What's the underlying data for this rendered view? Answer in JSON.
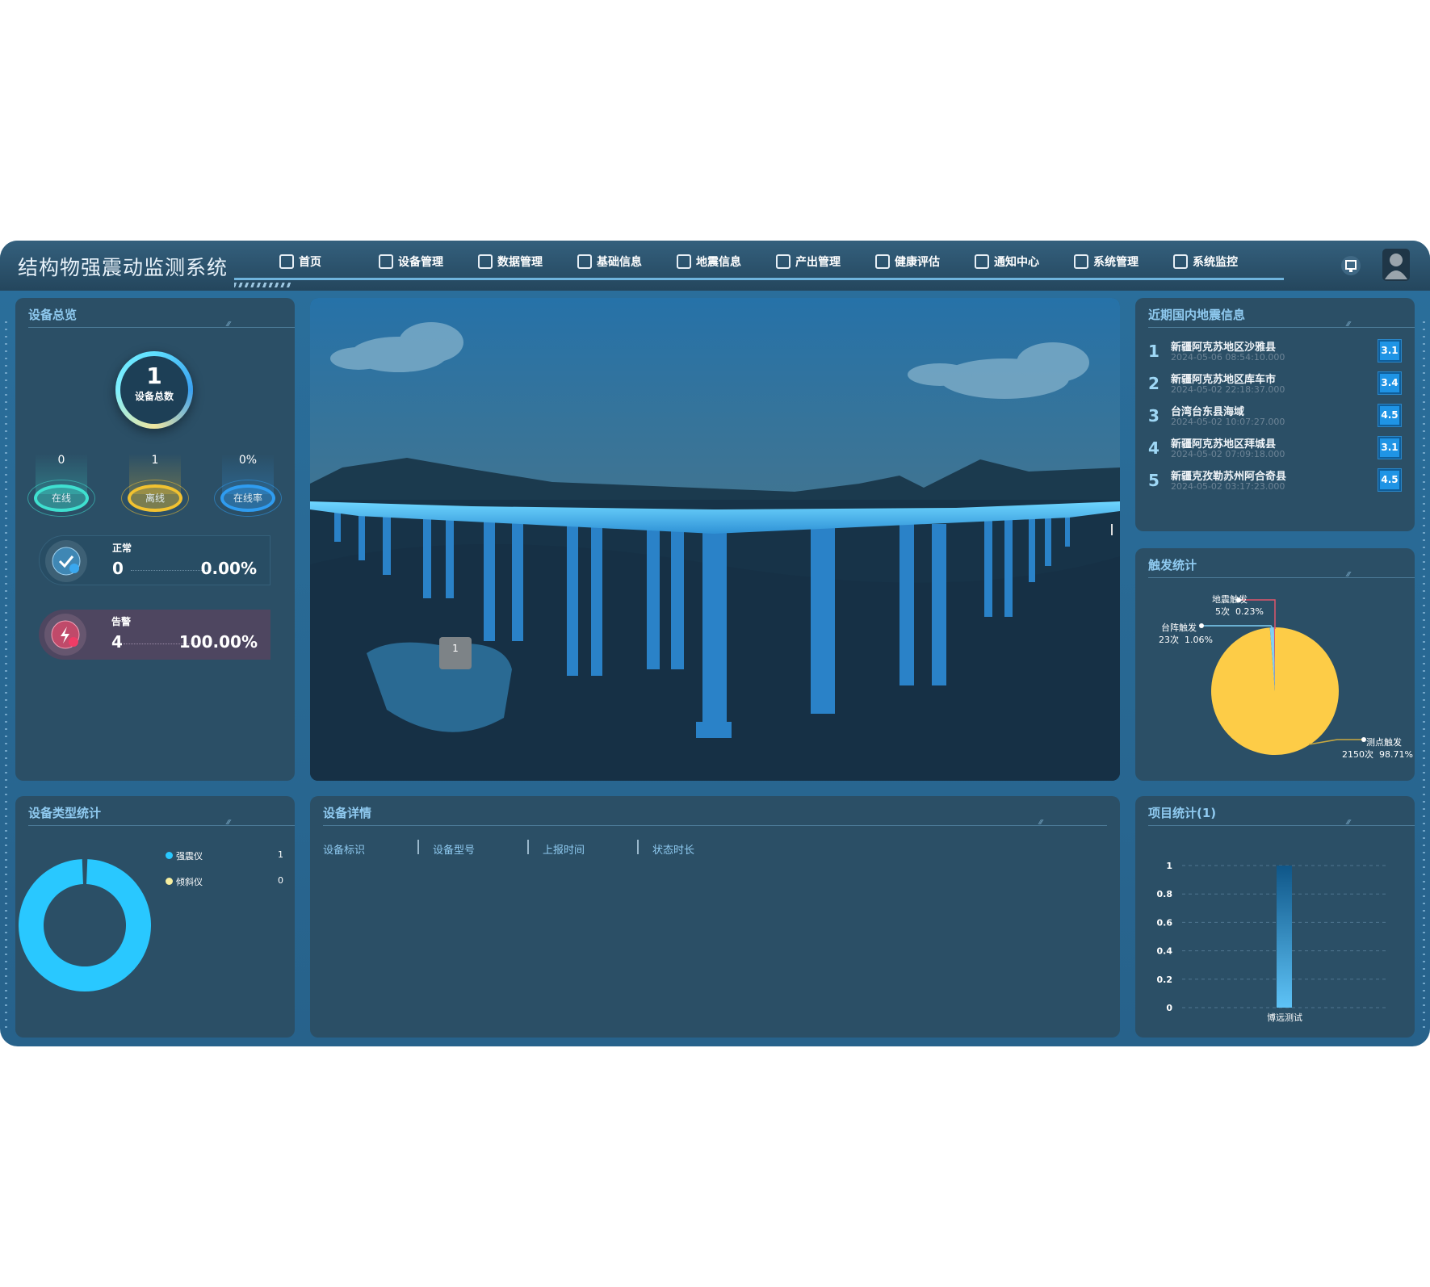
{
  "app": {
    "title": "结构物强震动监测系统"
  },
  "nav": [
    {
      "label": "首页",
      "icon": "home-icon"
    },
    {
      "label": "设备管理",
      "icon": "device-icon"
    },
    {
      "label": "数据管理",
      "icon": "bar-chart-icon"
    },
    {
      "label": "基础信息",
      "icon": "document-icon"
    },
    {
      "label": "地震信息",
      "icon": "file-icon"
    },
    {
      "label": "产出管理",
      "icon": "report-icon"
    },
    {
      "label": "健康评估",
      "icon": "monitor-heart-icon"
    },
    {
      "label": "通知中心",
      "icon": "bell-icon"
    },
    {
      "label": "系统管理",
      "icon": "gear-icon"
    },
    {
      "label": "系统监控",
      "icon": "screen-chart-icon"
    }
  ],
  "overview": {
    "title": "设备总览",
    "total": "1",
    "total_label": "设备总数",
    "stats": [
      {
        "value": "0",
        "label": "在线",
        "color": "#3fe0d0"
      },
      {
        "value": "1",
        "label": "离线",
        "color": "#f2c230"
      },
      {
        "value": "0%",
        "label": "在线率",
        "color": "#2f9cf0"
      }
    ],
    "normal": {
      "label": "正常",
      "count": "0",
      "percent": "0.00%"
    },
    "alarm": {
      "label": "告警",
      "count": "4",
      "percent": "100.00%"
    }
  },
  "scene": {
    "device_marker": "1"
  },
  "earthquakes": {
    "title": "近期国内地震信息",
    "items": [
      {
        "rank": "1",
        "place": "新疆阿克苏地区沙雅县",
        "time": "2024-05-06 08:54:10.000",
        "magnitude": "3.1"
      },
      {
        "rank": "2",
        "place": "新疆阿克苏地区库车市",
        "time": "2024-05-02 22:18:37.000",
        "magnitude": "3.4"
      },
      {
        "rank": "3",
        "place": "台湾台东县海域",
        "time": "2024-05-02 10:07:27.000",
        "magnitude": "4.5"
      },
      {
        "rank": "4",
        "place": "新疆阿克苏地区拜城县",
        "time": "2024-05-02 07:09:18.000",
        "magnitude": "3.1"
      },
      {
        "rank": "5",
        "place": "新疆克孜勒苏州阿合奇县",
        "time": "2024-05-02 03:17:23.000",
        "magnitude": "4.5"
      }
    ]
  },
  "device_detail": {
    "title": "设备详情",
    "columns": [
      "设备标识",
      "设备型号",
      "上报时间",
      "状态时长"
    ]
  },
  "chart_data": [
    {
      "type": "pie",
      "title": "触发统计",
      "slices": [
        {
          "name": "测点触发",
          "count_label": "2150次",
          "value": 2150,
          "percent": "98.71%",
          "color": "#fdcc47"
        },
        {
          "name": "台阵触发",
          "count_label": "23次",
          "value": 23,
          "percent": "1.06%",
          "color": "#7fd0f5"
        },
        {
          "name": "地震触发",
          "count_label": "5次",
          "value": 5,
          "percent": "0.23%",
          "color": "#e0566b"
        }
      ]
    },
    {
      "type": "pie",
      "title": "设备类型统计",
      "donut": true,
      "slices": [
        {
          "name": "强震仪",
          "value": 1,
          "color": "#29c8ff"
        },
        {
          "name": "倾斜仪",
          "value": 0,
          "color": "#f7efa0"
        }
      ]
    },
    {
      "type": "bar",
      "title": "项目统计(1)",
      "categories": [
        "博远测试"
      ],
      "values": [
        1
      ],
      "ylim": [
        0,
        1
      ],
      "yticks": [
        "0",
        "0.2",
        "0.4",
        "0.6",
        "0.8",
        "1"
      ],
      "grid": true
    }
  ]
}
